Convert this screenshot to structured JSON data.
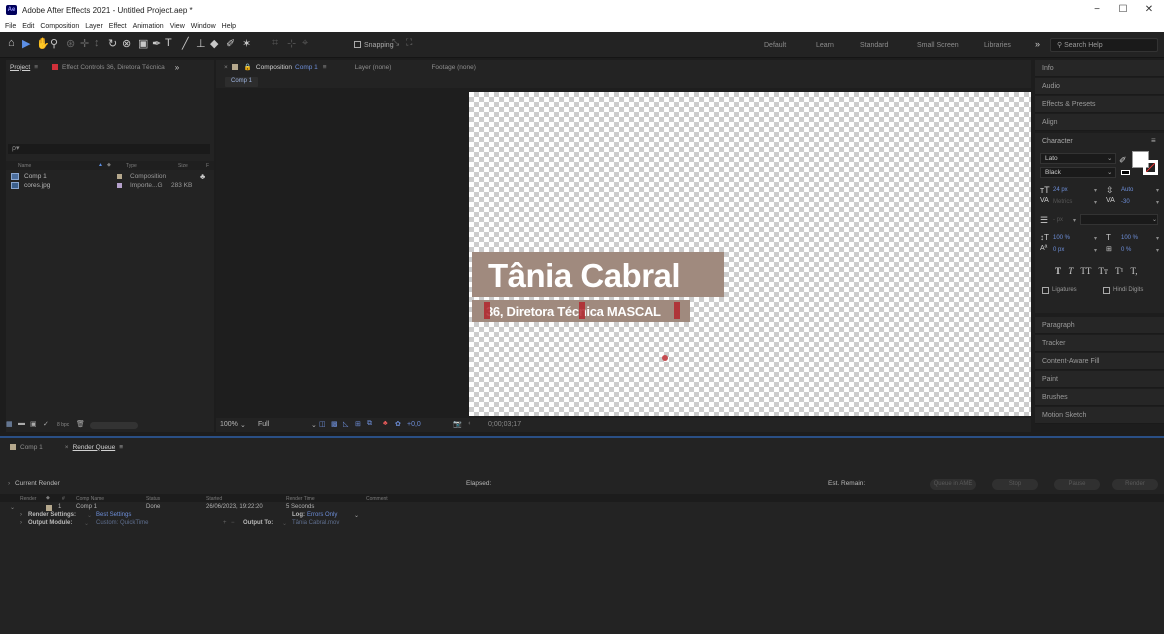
{
  "window": {
    "app_badge": "Ae",
    "title": "Adobe After Effects 2021 - Untitled Project.aep *",
    "minimize": "−",
    "maximize": "☐",
    "close": "✕"
  },
  "menu": [
    "File",
    "Edit",
    "Composition",
    "Layer",
    "Effect",
    "Animation",
    "View",
    "Window",
    "Help"
  ],
  "toolbar": {
    "snapping_label": "Snapping",
    "workspaces": [
      "Default",
      "Learn",
      "Standard",
      "Small Screen",
      "Libraries"
    ],
    "overflow": "»",
    "search_placeholder": "Search Help"
  },
  "project_panel": {
    "tab_project": "Project",
    "tab_menu": "≡",
    "tab_effect_controls": "Effect Controls 36, Diretora Técnica",
    "overflow": "»",
    "search_icon": "ρ▾",
    "columns": {
      "name": "Name",
      "type": "Type",
      "size": "Size",
      "f": "F"
    },
    "items": [
      {
        "name": "Comp 1",
        "type": "Composition",
        "size": "",
        "swatch": "#b5a88d"
      },
      {
        "name": "cores.jpg",
        "type": "Importe...G",
        "size": "283 KB",
        "swatch": "#b5a1cc"
      }
    ],
    "bpc": "8 bpc"
  },
  "comp_panel": {
    "close": "×",
    "tab_prefix": "Composition",
    "tab_name": "Comp 1",
    "tab_menu": "≡",
    "tab_layer": "Layer (none)",
    "tab_footage": "Footage (none)",
    "subtab": "Comp 1",
    "lower_third_name": "Tânia Cabral",
    "lower_third_role": "36, Diretora Técnica MASCAL",
    "zoom": "100%",
    "resolution": "Full",
    "exposure": "+0,0",
    "timecode": "0;00;03;17"
  },
  "right_panels": {
    "collapsed": [
      "Info",
      "Audio",
      "Effects & Presets",
      "Align"
    ],
    "character_title": "Character",
    "character_menu": "≡",
    "font_family": "Lato",
    "font_style": "Black",
    "font_size": "24 px",
    "leading": "Auto",
    "kerning": "Metrics",
    "tracking": "-30",
    "stroke_width": "- px",
    "vert_scale": "100 %",
    "horiz_scale": "100 %",
    "baseline_shift": "0 px",
    "tsume": "0 %",
    "text_styles": [
      "T",
      "T",
      "TT",
      "Tт",
      "T¹",
      "T,"
    ],
    "ligatures": "Ligatures",
    "hindi_digits": "Hindi Digits",
    "more": [
      "Paragraph",
      "Tracker",
      "Content-Aware Fill",
      "Paint",
      "Brushes",
      "Motion Sketch"
    ]
  },
  "render_queue": {
    "tab_comp": "Comp 1",
    "tab_close": "×",
    "tab_rq": "Render Queue",
    "tab_menu": "≡",
    "current_render": "Current Render",
    "elapsed": "Elapsed:",
    "est_remain": "Est. Remain:",
    "buttons": [
      "Queue in AME",
      "Stop",
      "Pause",
      "Render"
    ],
    "columns": {
      "render": "Render",
      "num": "#",
      "comp_name": "Comp Name",
      "status": "Status",
      "started": "Started",
      "render_time": "Render Time",
      "comment": "Comment"
    },
    "row": {
      "num": "1",
      "comp": "Comp 1",
      "status": "Done",
      "started": "26/06/2023, 19:22:20",
      "render_time": "5 Seconds"
    },
    "render_settings_label": "Render Settings:",
    "render_settings_value": "Best Settings",
    "log_label": "Log:",
    "log_value": "Errors Only",
    "output_module_label": "Output Module:",
    "output_module_value": "Custom: QuickTime",
    "output_to_label": "Output To:",
    "output_to_value": "Tânia Cabral.mov"
  }
}
